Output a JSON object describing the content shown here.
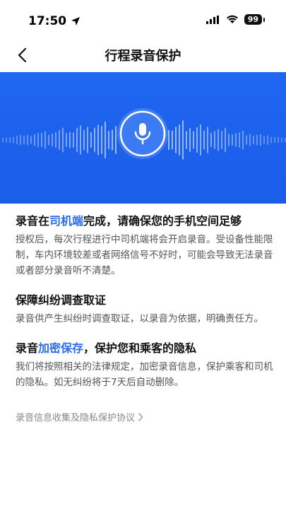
{
  "status": {
    "time": "17:50",
    "battery": "99"
  },
  "nav": {
    "title": "行程录音保护"
  },
  "sections": [
    {
      "title_pre": "录音在",
      "title_highlight": "司机端",
      "title_post": "完成，请确保您的手机空间足够",
      "body": "授权后，每次行程进行中司机端将会开启录音。受设备性能限制，车内环境较差或者网络信号不好时，可能会导致无法录音或者部分录音听不清楚。"
    },
    {
      "title": "保障纠纷调查取证",
      "body": "录音供产生纠纷时调查取证，以录音为依据，明确责任方。"
    },
    {
      "title_pre": "录音",
      "title_highlight": "加密保存",
      "title_post": "，保护您和乘客的隐私",
      "body": "我们将按照相关的法律规定，加密录音信息，保护乘客和司机的隐私。如无纠纷将于7天后自动删除。"
    }
  ],
  "agreement_link": "录音信息收集及隐私保护协议",
  "icons": {
    "back": "chevron-left-icon",
    "mic": "microphone-icon",
    "arrow": "chevron-right-icon",
    "location": "location-arrow-icon",
    "signal": "cellular-signal-icon",
    "wifi": "wifi-icon"
  },
  "colors": {
    "banner": "#1f66f0",
    "highlight": "#2a6cf0"
  }
}
